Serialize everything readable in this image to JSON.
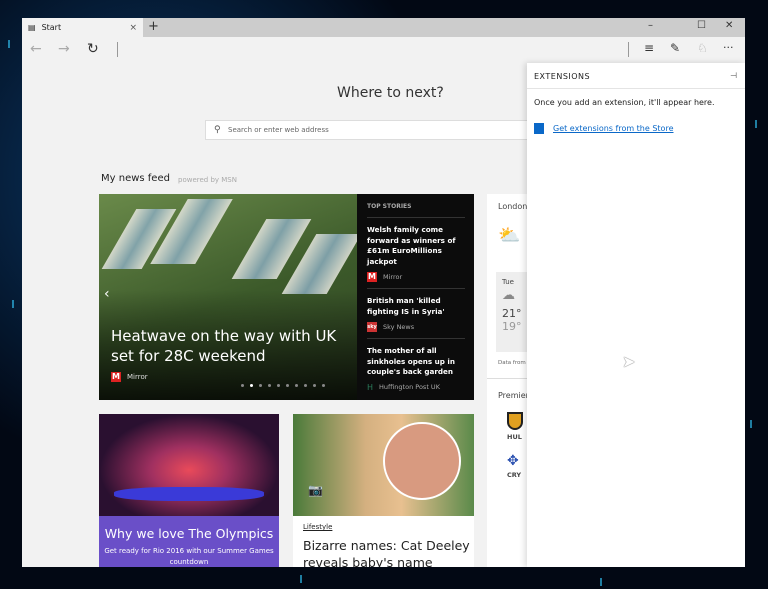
{
  "tab": {
    "label": "Start",
    "close": "×",
    "new_tab": "+"
  },
  "window_controls": {
    "minimize": "–",
    "maximize": "☐",
    "close": "✕"
  },
  "toolbar": {
    "back": "←",
    "forward": "→",
    "refresh": "↻",
    "hub": "≡",
    "note": "✎",
    "share": "♘",
    "more": "···"
  },
  "page": {
    "title": "Where to next?",
    "search_placeholder": "Search or enter web address",
    "feed_title": "My news feed",
    "powered_by": "powered by MSN"
  },
  "hero": {
    "headline": "Heatwave on the way with UK set for 28C weekend",
    "source": "Mirror",
    "prev": "‹",
    "next": "›",
    "slides": 10,
    "active_slide": 2
  },
  "top_stories": {
    "header": "TOP STORIES",
    "items": [
      {
        "title": "Welsh family come forward as winners of £61m EuroMillions jackpot",
        "source": "Mirror",
        "logo": "M"
      },
      {
        "title": "British man 'killed fighting IS in Syria'",
        "source": "Sky News",
        "logo": "sky"
      },
      {
        "title": "The mother of all sinkholes opens up in couple's back garden",
        "source": "Huffington Post UK",
        "logo": "H"
      }
    ]
  },
  "weather": {
    "city": "London",
    "day": "Tue",
    "high": "21°",
    "low": "19°",
    "data_from": "Data from"
  },
  "sports": {
    "title": "Premier",
    "teams": [
      "HUL",
      "CRY"
    ]
  },
  "extensions": {
    "title": "EXTENSIONS",
    "message": "Once you add an extension, it'll appear here.",
    "link": "Get extensions from the Store"
  },
  "cards": [
    {
      "title": "Why we love The Olympics",
      "subtitle": "Get ready for Rio 2016 with our Summer Games countdown"
    },
    {
      "category": "Lifestyle",
      "title": "Bizarre names: Cat Deeley reveals baby's name"
    }
  ]
}
